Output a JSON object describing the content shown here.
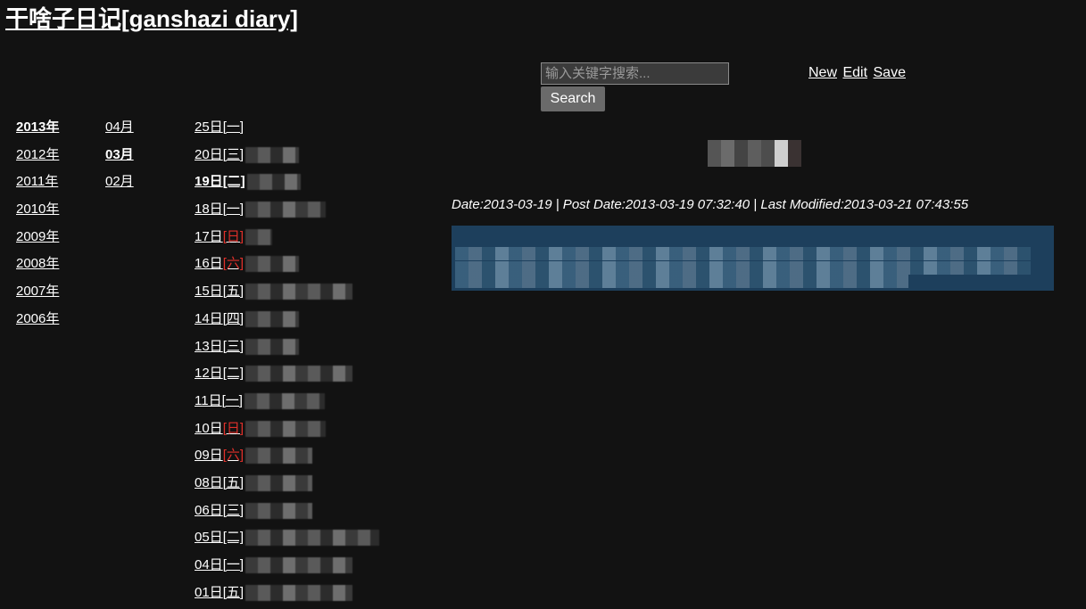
{
  "site": {
    "title": "干啥子日记[ganshazi diary]"
  },
  "search": {
    "placeholder": "输入关键字搜索...",
    "value": "",
    "button_label": "Search"
  },
  "actions": {
    "new_label": "New",
    "edit_label": "Edit",
    "save_label": "Save"
  },
  "years": [
    {
      "label": "2013年",
      "selected": true
    },
    {
      "label": "2012年",
      "selected": false
    },
    {
      "label": "2011年",
      "selected": false
    },
    {
      "label": "2010年",
      "selected": false
    },
    {
      "label": "2009年",
      "selected": false
    },
    {
      "label": "2008年",
      "selected": false
    },
    {
      "label": "2007年",
      "selected": false
    },
    {
      "label": "2006年",
      "selected": false
    }
  ],
  "months": [
    {
      "label": "04月",
      "selected": false
    },
    {
      "label": "03月",
      "selected": true
    },
    {
      "label": "02月",
      "selected": false
    }
  ],
  "days": [
    {
      "day": "25日",
      "weekday": "[一]",
      "weekend": false,
      "selected": false
    },
    {
      "day": "20日",
      "weekday": "[三]",
      "weekend": false,
      "selected": false
    },
    {
      "day": "19日",
      "weekday": "[二]",
      "weekend": false,
      "selected": true
    },
    {
      "day": "18日",
      "weekday": "[一]",
      "weekend": false,
      "selected": false
    },
    {
      "day": "17日",
      "weekday": "[日]",
      "weekend": true,
      "selected": false
    },
    {
      "day": "16日",
      "weekday": "[六]",
      "weekend": true,
      "selected": false
    },
    {
      "day": "15日",
      "weekday": "[五]",
      "weekend": false,
      "selected": false
    },
    {
      "day": "14日",
      "weekday": "[四]",
      "weekend": false,
      "selected": false
    },
    {
      "day": "13日",
      "weekday": "[三]",
      "weekend": false,
      "selected": false
    },
    {
      "day": "12日",
      "weekday": "[二]",
      "weekend": false,
      "selected": false
    },
    {
      "day": "11日",
      "weekday": "[一]",
      "weekend": false,
      "selected": false
    },
    {
      "day": "10日",
      "weekday": "[日]",
      "weekend": true,
      "selected": false
    },
    {
      "day": "09日",
      "weekday": "[六]",
      "weekend": true,
      "selected": false
    },
    {
      "day": "08日",
      "weekday": "[五]",
      "weekend": false,
      "selected": false
    },
    {
      "day": "06日",
      "weekday": "[三]",
      "weekend": false,
      "selected": false
    },
    {
      "day": "05日",
      "weekday": "[二]",
      "weekend": false,
      "selected": false
    },
    {
      "day": "04日",
      "weekday": "[一]",
      "weekend": false,
      "selected": false
    },
    {
      "day": "01日",
      "weekday": "[五]",
      "weekend": false,
      "selected": false
    }
  ],
  "entry": {
    "meta": "Date:2013-03-19 | Post Date:2013-03-19 07:32:40 | Last Modified:2013-03-21 07:43:55"
  },
  "colors": {
    "background": "#121212",
    "weekend": "#e0302a",
    "entry_body": "#1d3f5c"
  }
}
